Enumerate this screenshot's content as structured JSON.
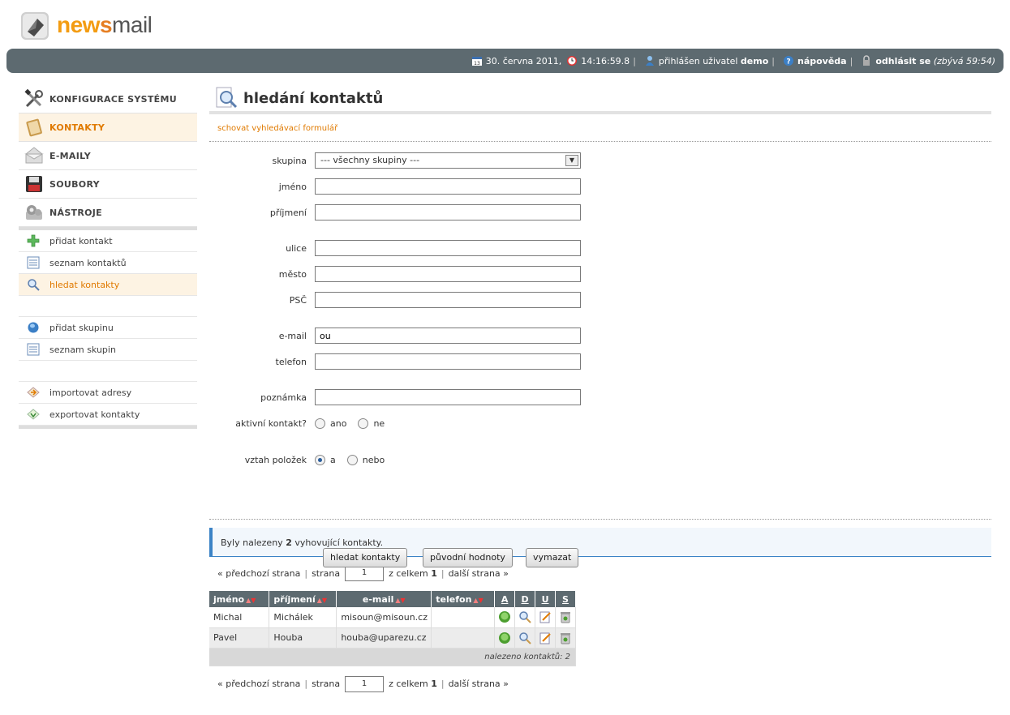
{
  "logo": {
    "news": "new",
    "s": "s",
    "mail": "mail"
  },
  "topbar": {
    "date": "30. června 2011,",
    "time": "14:16:59.8",
    "logged_prefix": "přihlášen uživatel",
    "user": "demo",
    "help": "nápověda",
    "logout": "odhlásit se",
    "remaining": "(zbývá 59:54)"
  },
  "sidebar": {
    "main": [
      {
        "label": "KONFIGURACE SYSTÉMU",
        "icon": "tools-icon"
      },
      {
        "label": "KONTAKTY",
        "icon": "address-book-icon"
      },
      {
        "label": "E-MAILY",
        "icon": "envelope-icon"
      },
      {
        "label": "SOUBORY",
        "icon": "floppy-icon"
      },
      {
        "label": "NÁSTROJE",
        "icon": "gears-icon"
      }
    ],
    "sub": [
      {
        "label": "přidat kontakt",
        "icon": "plus-icon"
      },
      {
        "label": "seznam kontaktů",
        "icon": "list-icon"
      },
      {
        "label": "hledat kontakty",
        "icon": "magnifier-icon"
      },
      {
        "label": "přidat skupinu",
        "icon": "globe-icon"
      },
      {
        "label": "seznam skupin",
        "icon": "list-icon"
      },
      {
        "label": "importovat adresy",
        "icon": "import-icon"
      },
      {
        "label": "exportovat kontakty",
        "icon": "export-icon"
      }
    ]
  },
  "page": {
    "title": "hledání kontaktů",
    "hide_form": "schovat vyhledávací formulář"
  },
  "form": {
    "group_label": "skupina",
    "group_value": "--- všechny skupiny ---",
    "firstname_label": "jméno",
    "firstname_value": "",
    "lastname_label": "příjmení",
    "lastname_value": "",
    "street_label": "ulice",
    "street_value": "",
    "city_label": "město",
    "city_value": "",
    "zip_label": "PSČ",
    "zip_value": "",
    "email_label": "e-mail",
    "email_value": "ou",
    "phone_label": "telefon",
    "phone_value": "",
    "note_label": "poznámka",
    "note_value": "",
    "active_label": "aktivní kontakt?",
    "active_yes": "ano",
    "active_no": "ne",
    "relation_label": "vztah položek",
    "relation_and": "a",
    "relation_or": "nebo",
    "search_button": "hledat kontakty",
    "reset_button": "původní hodnoty",
    "clear_button": "vymazat"
  },
  "result": {
    "prefix": "Byly nalezeny",
    "count": "2",
    "suffix": "vyhovující kontakty."
  },
  "pager": {
    "prev": "« předchozí strana",
    "page_label": "strana",
    "page_value": "1",
    "total_label": "z celkem",
    "total": "1",
    "next": "další strana »"
  },
  "table": {
    "headers": {
      "firstname": "jméno",
      "lastname": "příjmení",
      "email": "e-mail",
      "phone": "telefon",
      "a": "A",
      "d": "D",
      "u": "U",
      "s": "S"
    },
    "rows": [
      {
        "firstname": "Michal",
        "lastname": "Michálek",
        "email": "misoun@misoun.cz",
        "phone": ""
      },
      {
        "firstname": "Pavel",
        "lastname": "Houba",
        "email": "houba@uparezu.cz",
        "phone": ""
      }
    ],
    "footer": "nalezeno kontaktů: 2"
  }
}
